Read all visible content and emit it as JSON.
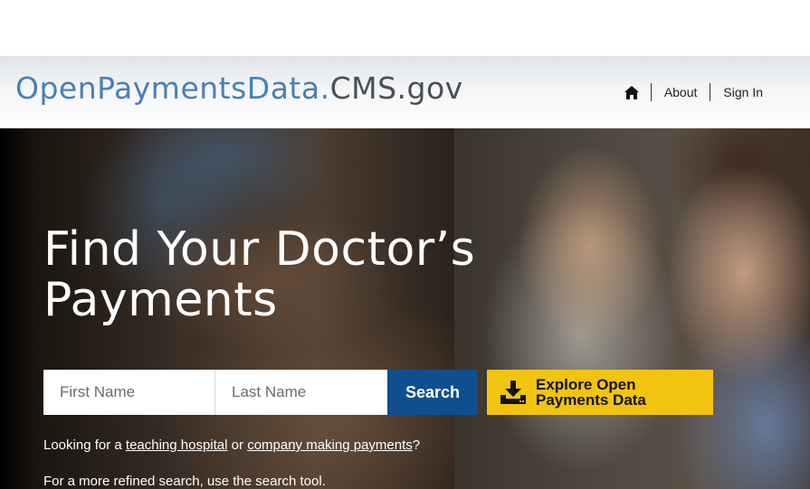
{
  "header": {
    "logo_part1": "OpenPaymentsData.",
    "logo_part2": "CMS.gov",
    "nav": {
      "home_icon": "home-icon",
      "about": "About",
      "sign_in": "Sign In"
    }
  },
  "hero": {
    "title_line1": "Find Your Doctor’s",
    "title_line2": "Payments",
    "search": {
      "first_name_placeholder": "First Name",
      "last_name_placeholder": "Last Name",
      "button_label": "Search"
    },
    "explore": {
      "icon": "download-icon",
      "label_line1": "Explore Open",
      "label_line2": "Payments Data"
    },
    "hint1": {
      "prefix": "Looking for a ",
      "link1": "teaching hospital",
      "middle": " or ",
      "link2": "company making payments",
      "suffix": "?"
    },
    "hint2": "For a more refined search, use the search tool."
  },
  "colors": {
    "logo_blue": "#4a7fb5",
    "logo_gray": "#4b4f55",
    "search_button": "#0f4f8f",
    "explore_button": "#f1c40f"
  }
}
